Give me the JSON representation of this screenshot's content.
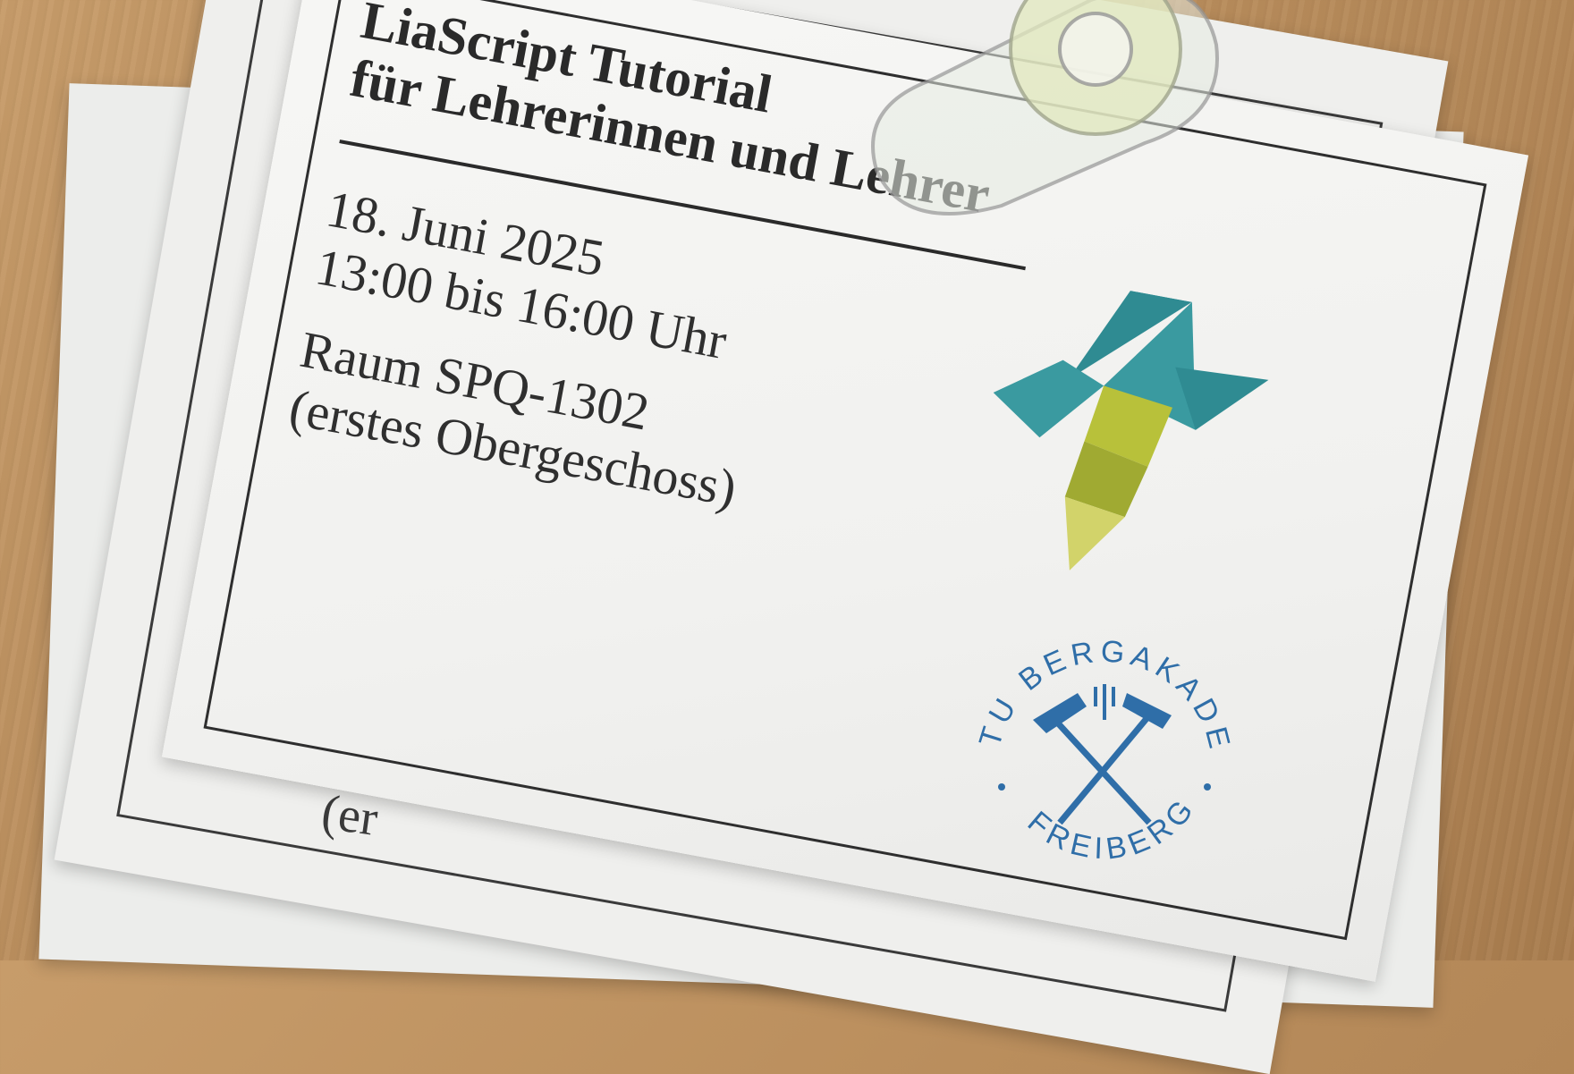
{
  "poster": {
    "title_line1": "LiaScript Tutorial",
    "title_line2": "für Lehrerinnen und Lehrer",
    "date": "18. Juni 2025",
    "time": "13:00 bis 16:00 Uhr",
    "room": "Raum SPQ-1302",
    "room_note": "(erstes Obergeschoss)"
  },
  "back_sheet": {
    "visible_text": "(er"
  },
  "logos": {
    "tangram_bird": "tangram-bird-logo",
    "university_seal_text_top": "TU BERGAKADEMIE",
    "university_seal_text_bottom": "FREIBERG"
  },
  "colors": {
    "teal": "#3a9aa0",
    "teal_dark": "#2f8b92",
    "olive": "#b8c13a",
    "olive_light": "#d2d36a",
    "olive_dark": "#a0aa32",
    "seal_blue": "#2f6ea8",
    "ink": "#2a2a2a"
  }
}
